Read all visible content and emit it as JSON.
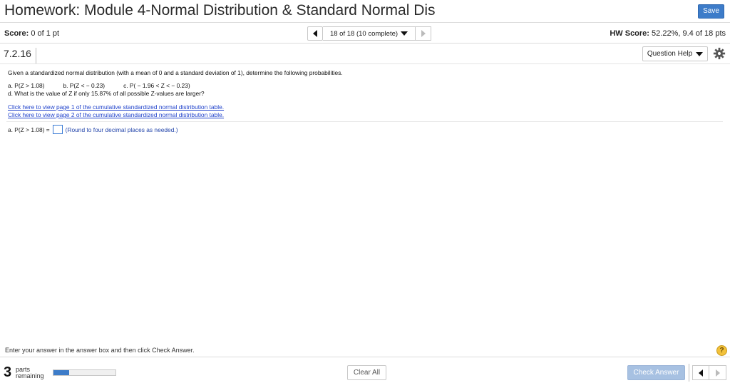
{
  "header": {
    "title": "Homework: Module 4-Normal Distribution & Standard Normal Dis",
    "save_label": "Save"
  },
  "scorebar": {
    "score_label": "Score:",
    "score_value": "0 of 1 pt",
    "nav_text": "18 of 18 (10 complete)",
    "hw_score_label": "HW Score:",
    "hw_score_value": "52.22%, 9.4 of 18 pts"
  },
  "question_bar": {
    "number": "7.2.16",
    "help_label": "Question Help"
  },
  "question": {
    "intro": "Given a standardized normal distribution (with a mean of 0 and a standard deviation of 1), determine the following probabilities.",
    "part_a": "a. P(Z > 1.08)",
    "part_b": "b. P(Z < − 0.23)",
    "part_c": "c. P( − 1.96 < Z < − 0.23)",
    "part_d": "d. What is the value of Z if only 15.87% of all possible Z-values are larger?",
    "link_1": "Click here to view page 1 of the cumulative standardized normal distribution table.",
    "link_2": "Click here to view page 2 of the cumulative standardized normal distribution table.",
    "answer_prompt": "a. P(Z > 1.08) =",
    "answer_value": "",
    "answer_hint": "(Round to four decimal places as needed.)"
  },
  "footer": {
    "instruction": "Enter your answer in the answer box and then click Check Answer.",
    "help_symbol": "?",
    "parts_count": "3",
    "parts_label_1": "parts",
    "parts_label_2": "remaining",
    "progress_fraction": 0.25,
    "clear_label": "Clear All",
    "check_label": "Check Answer"
  },
  "colors": {
    "accent": "#3d7cc9",
    "link": "#2244cc",
    "help_badge": "#f2c13a",
    "check_disabled": "#a7c1e2"
  },
  "icons": [
    "chevron-left-icon",
    "chevron-right-icon",
    "dropdown-arrow-icon",
    "gear-icon",
    "help-icon"
  ]
}
